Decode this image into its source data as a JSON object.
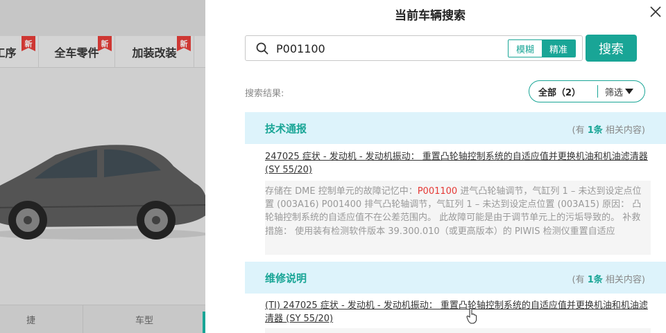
{
  "background": {
    "tabs": [
      {
        "label": "工序",
        "badge": "新"
      },
      {
        "label": "全车零件",
        "badge": "新"
      },
      {
        "label": "加装改装",
        "badge": "新"
      }
    ],
    "bottom_items": [
      "捷",
      "车型"
    ]
  },
  "drawer": {
    "title": "当前车辆搜索",
    "search": {
      "value": "P001100",
      "placeholder": "",
      "modes": {
        "fuzzy": "模糊",
        "exact": "精准"
      },
      "active_mode": "exact",
      "button_label": "搜索"
    },
    "results_label": "搜索结果:",
    "filter": {
      "all_label": "全部（2）",
      "filter_label": "筛选"
    },
    "sections": [
      {
        "title": "技术通报",
        "count_prefix": "(有",
        "count_num": "1条",
        "count_suffix": "相关内容)",
        "item_title": "247025 症状 - 发动机 - 发动机振动： 重置凸轮轴控制系统的自适应值并更换机油和机油滤清器 (SY 55/20)",
        "snippet_before": "存储在 DME 控制单元的故障记忆中：",
        "snippet_highlight": "P001100",
        "snippet_after": " 进气凸轮轴调节，气缸列 1 – 未达到设定点位置 (003A16) P001400 排气凸轮轴调节，气缸列 1 – 未达到设定点位置 (003A15) 原因： 凸轮轴控制系统的自适应值不在公差范围内。 此故障可能是由于调节单元上的污垢导致的。 补救措施： 使用装有检测软件版本 39.300.010（或更高版本）的 PIWIS 检测仪重置自适应"
      },
      {
        "title": "维修说明",
        "count_prefix": "(有",
        "count_num": "1条",
        "count_suffix": "相关内容)",
        "item_title": "(TI) 247025 症状 - 发动机 - 发动机振动： 重置凸轮轴控制系统的自适应值并更换机油和机油滤清器 (SY 55/20)"
      }
    ]
  },
  "colors": {
    "accent": "#19a596",
    "highlight": "#e53935",
    "section_bg": "#ddf3fb"
  }
}
